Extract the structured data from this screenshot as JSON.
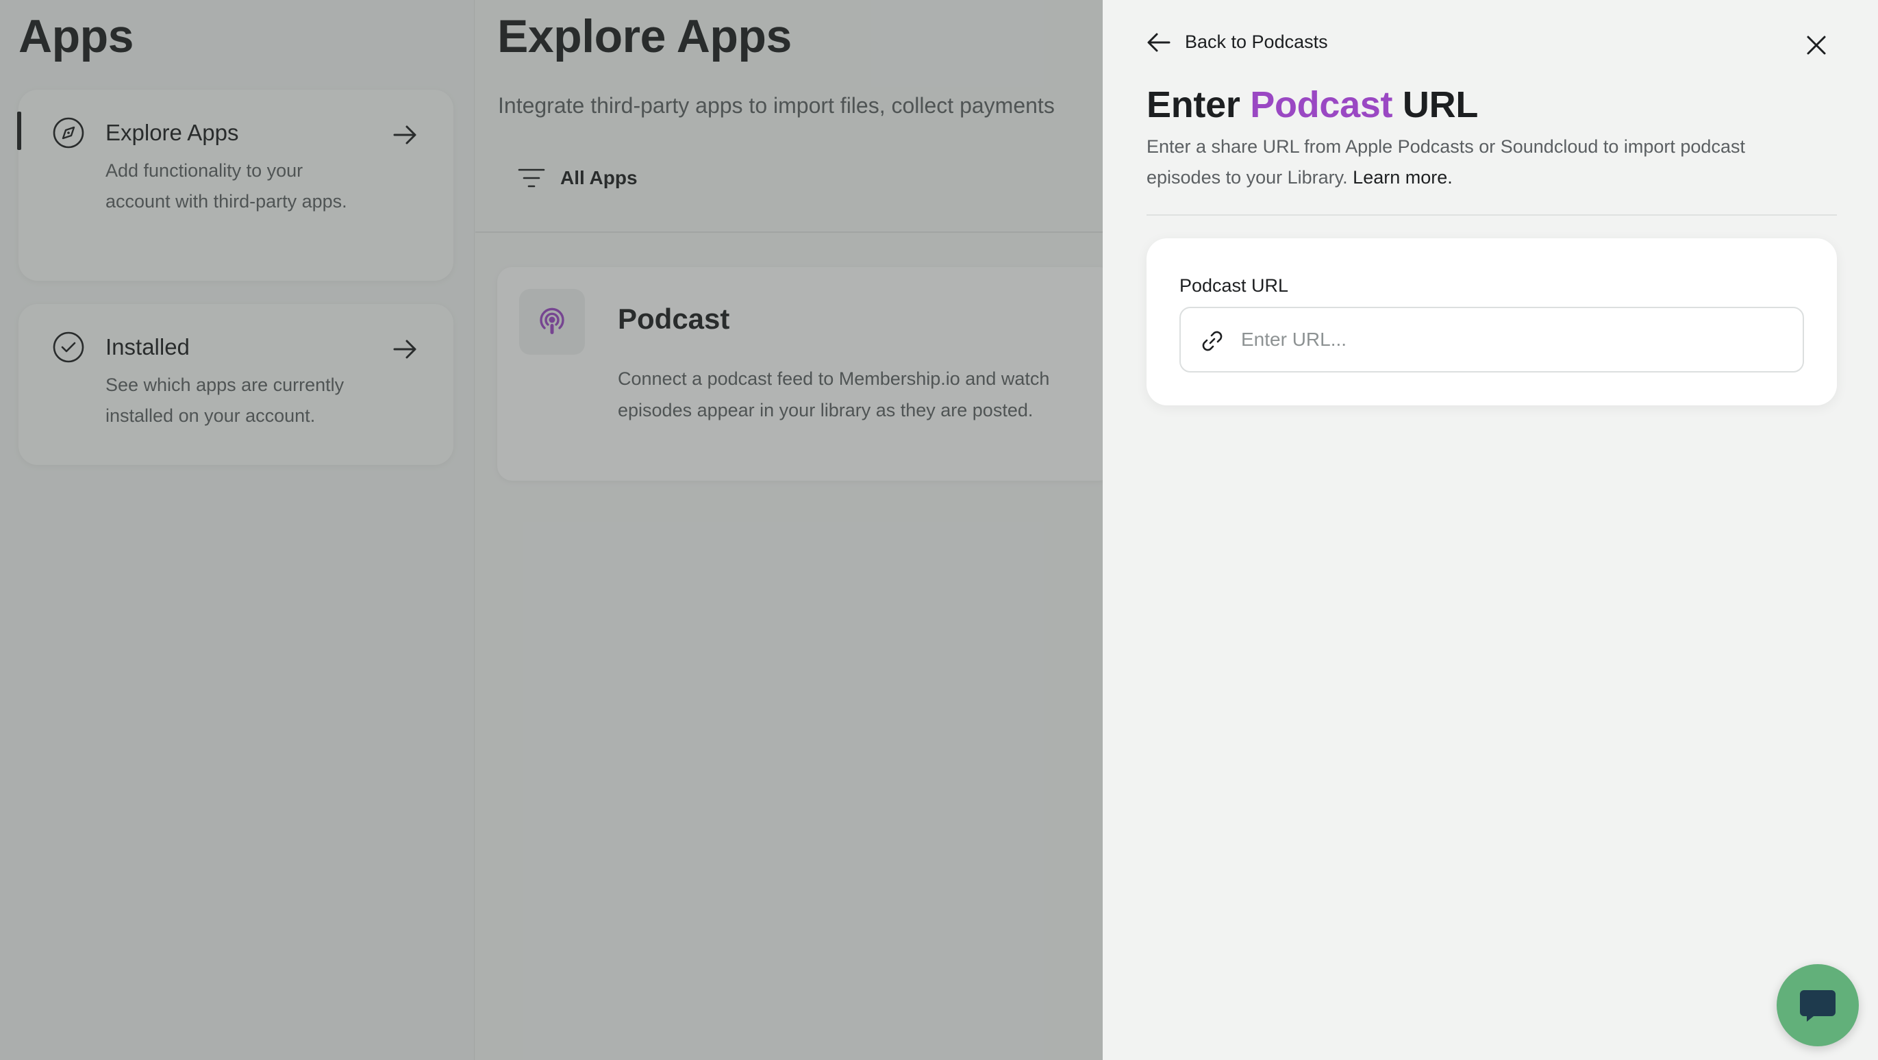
{
  "left": {
    "title": "Apps",
    "nav": [
      {
        "title": "Explore Apps",
        "description": "Add functionality to your account with third-party apps.",
        "icon": "compass-icon",
        "active": true
      },
      {
        "title": "Installed",
        "description": "See which apps are currently installed on your account.",
        "icon": "check-circle-icon",
        "active": false
      }
    ]
  },
  "middle": {
    "title": "Explore Apps",
    "subtitle": "Integrate third-party apps to import files, collect payments",
    "filter_label": "All Apps",
    "app": {
      "name": "Podcast",
      "description": "Connect a podcast feed to Membership.io and watch episodes appear in your library as they are posted.",
      "icon": "podcast-icon"
    }
  },
  "drawer": {
    "back_label": "Back to Podcasts",
    "title_prefix": "Enter",
    "title_accent": "Podcast",
    "title_suffix": "URL",
    "description": "Enter a share URL from Apple Podcasts or Soundcloud to import podcast episodes to your Library.",
    "learn_more": "Learn more.",
    "field_label": "Podcast URL",
    "field_placeholder": "Enter URL...",
    "field_value": ""
  },
  "colors": {
    "accent": "#9a48c3",
    "chat": "#62b07a",
    "overlay": "rgba(60,66,64,0.38)"
  }
}
